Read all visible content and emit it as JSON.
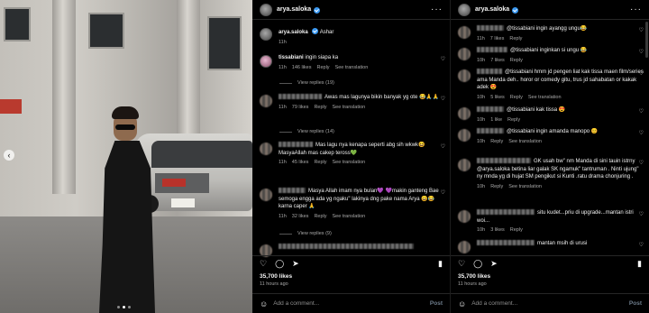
{
  "p1": {
    "username": "arya.saloka",
    "caption": {
      "user": "arya.saloka",
      "text": "Ashar",
      "time": "11h"
    },
    "comments": [
      {
        "user": "tissabiani",
        "text": "ingin siapa ka",
        "time": "11h",
        "likes": "146 likes",
        "reply": "Reply",
        "translate": "See translation",
        "replies": "View replies (19)"
      },
      {
        "user": "",
        "text": "Awas mas lagunya bikin banyak yg ote 😂🙏🙏",
        "time": "11h",
        "likes": "79 likes",
        "reply": "Reply",
        "translate": "See translation",
        "replies": "View replies (14)"
      },
      {
        "user": "",
        "text": "Mas lagu nya kenapa seperti abg sih wkwk😆 MasyaAllah mas cakep teross💚",
        "time": "11h",
        "likes": "45 likes",
        "reply": "Reply",
        "translate": "See translation",
        "replies": ""
      },
      {
        "user": "",
        "text": "Masya Allah imam nya bulan💜 💜makin ganteng Bae semoga engga ada yg ngaku\" lakinya dng pake nama Arya 😄😂 karna caper 🙏",
        "time": "11h",
        "likes": "32 likes",
        "reply": "Reply",
        "translate": "See translation",
        "replies": "View replies (9)"
      }
    ],
    "likes": "35,700 likes",
    "ago": "11 hours ago",
    "add_comment": "Add a comment...",
    "post": "Post"
  },
  "p2": {
    "username": "arya.saloka",
    "comments": [
      {
        "text": "@tissabiani ingin ayangg ungu😂",
        "time": "11h",
        "likes": "7 likes",
        "reply": "Reply"
      },
      {
        "text": "@tissabiani inginkan si ungu 😂",
        "time": "10h",
        "likes": "7 likes",
        "reply": "Reply"
      },
      {
        "text": "@tissabiani hmm jd pengen liat kak tissa maen film/series ama Manda deh.. horor or comedy gitu, trus jd sahabatan or kakak adek 😍",
        "time": "10h",
        "likes": "5 likes",
        "reply": "Reply",
        "translate": "See translation"
      },
      {
        "text": "@tissabiani kak tissa 😍",
        "time": "10h",
        "likes": "1 like",
        "reply": "Reply"
      },
      {
        "text": "@tissabiani ingin amanda manopo 😊",
        "time": "10h",
        "likes": "",
        "reply": "Reply",
        "translate": "See translation"
      },
      {
        "text": "GK usah bw\" nm Manda di sini tauin istrny @arya.saloka betina liar galak SK ngamuk\" tantruman . Ninti ujung\" ny mnda yg di hujat SM pengikut si Kunti .ratu drama chonjuring .",
        "time": "10h",
        "likes": "",
        "reply": "Reply",
        "translate": "See translation"
      },
      {
        "text": "situ kudet...priu di upgrade...mantan istri woi...",
        "time": "10h",
        "likes": "3 likes",
        "reply": "Reply"
      },
      {
        "text": "mantan msih di urusi",
        "time": "",
        "likes": "",
        "reply": ""
      }
    ],
    "likes": "35,700 likes",
    "ago": "11 hours ago",
    "add_comment": "Add a comment...",
    "post": "Post"
  },
  "icons": {
    "heart": "heart-icon",
    "comment": "comment-icon",
    "share": "share-icon",
    "bookmark": "bookmark-icon"
  }
}
